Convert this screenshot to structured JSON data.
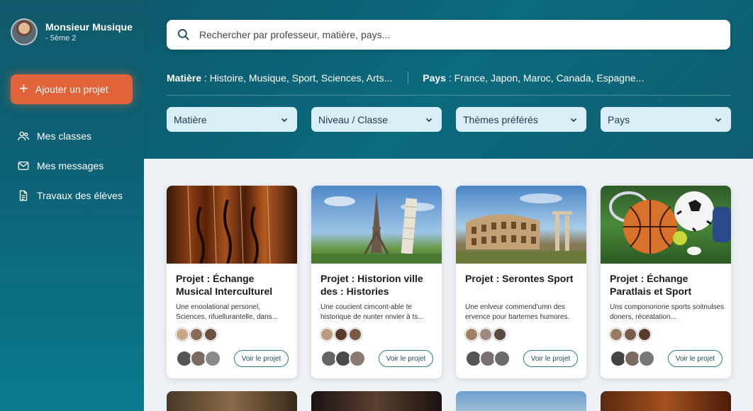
{
  "user": {
    "name": "Monsieur Musique",
    "subtitle": "- 5ème 2"
  },
  "sidebar": {
    "add_label": "Ajouter un projet",
    "items": [
      {
        "label": "Mes classes",
        "icon": "users-icon"
      },
      {
        "label": "Mes messages",
        "icon": "mail-icon"
      },
      {
        "label": "Travaux des élèves",
        "icon": "document-icon"
      }
    ]
  },
  "search": {
    "placeholder": "Rechercher par professeur, matière, pays..."
  },
  "filters": {
    "subject_key": "Matière",
    "subject_values": " : Histoire, Musique, Sport, Sciences, Arts...",
    "country_key": "Pays",
    "country_values": " : France, Japon, Maroc, Canada, Espagne..."
  },
  "dropdowns": [
    "Matière",
    "Niveau / Classe",
    "Thèmes préférés",
    "Pays"
  ],
  "cards": [
    {
      "title": "Projet : Échange Musical Interculturel",
      "desc": "Une enoolational personel, Sciences, rifuellurantelle, dans...",
      "button": "Voir le projet"
    },
    {
      "title": "Projet : Historion ville des : Histories",
      "desc": "Une coucient cimcont-able te historique de nunter nnvier à ts...",
      "button": "Voir le projet"
    },
    {
      "title": "Projet : Serontes Sport",
      "desc": "Une enlveur commend'umn des ervence pour bartemes humores.",
      "button": "Voir le projet"
    },
    {
      "title": "Projet : Échange Paratlais et Sport",
      "desc": "Uns componoriorie sports soitnulses doners, réceatation...",
      "button": "Voir le projet"
    }
  ],
  "colors": {
    "accent": "#e0633a",
    "header": "#0d6377",
    "dropdown": "#d9eef7"
  }
}
